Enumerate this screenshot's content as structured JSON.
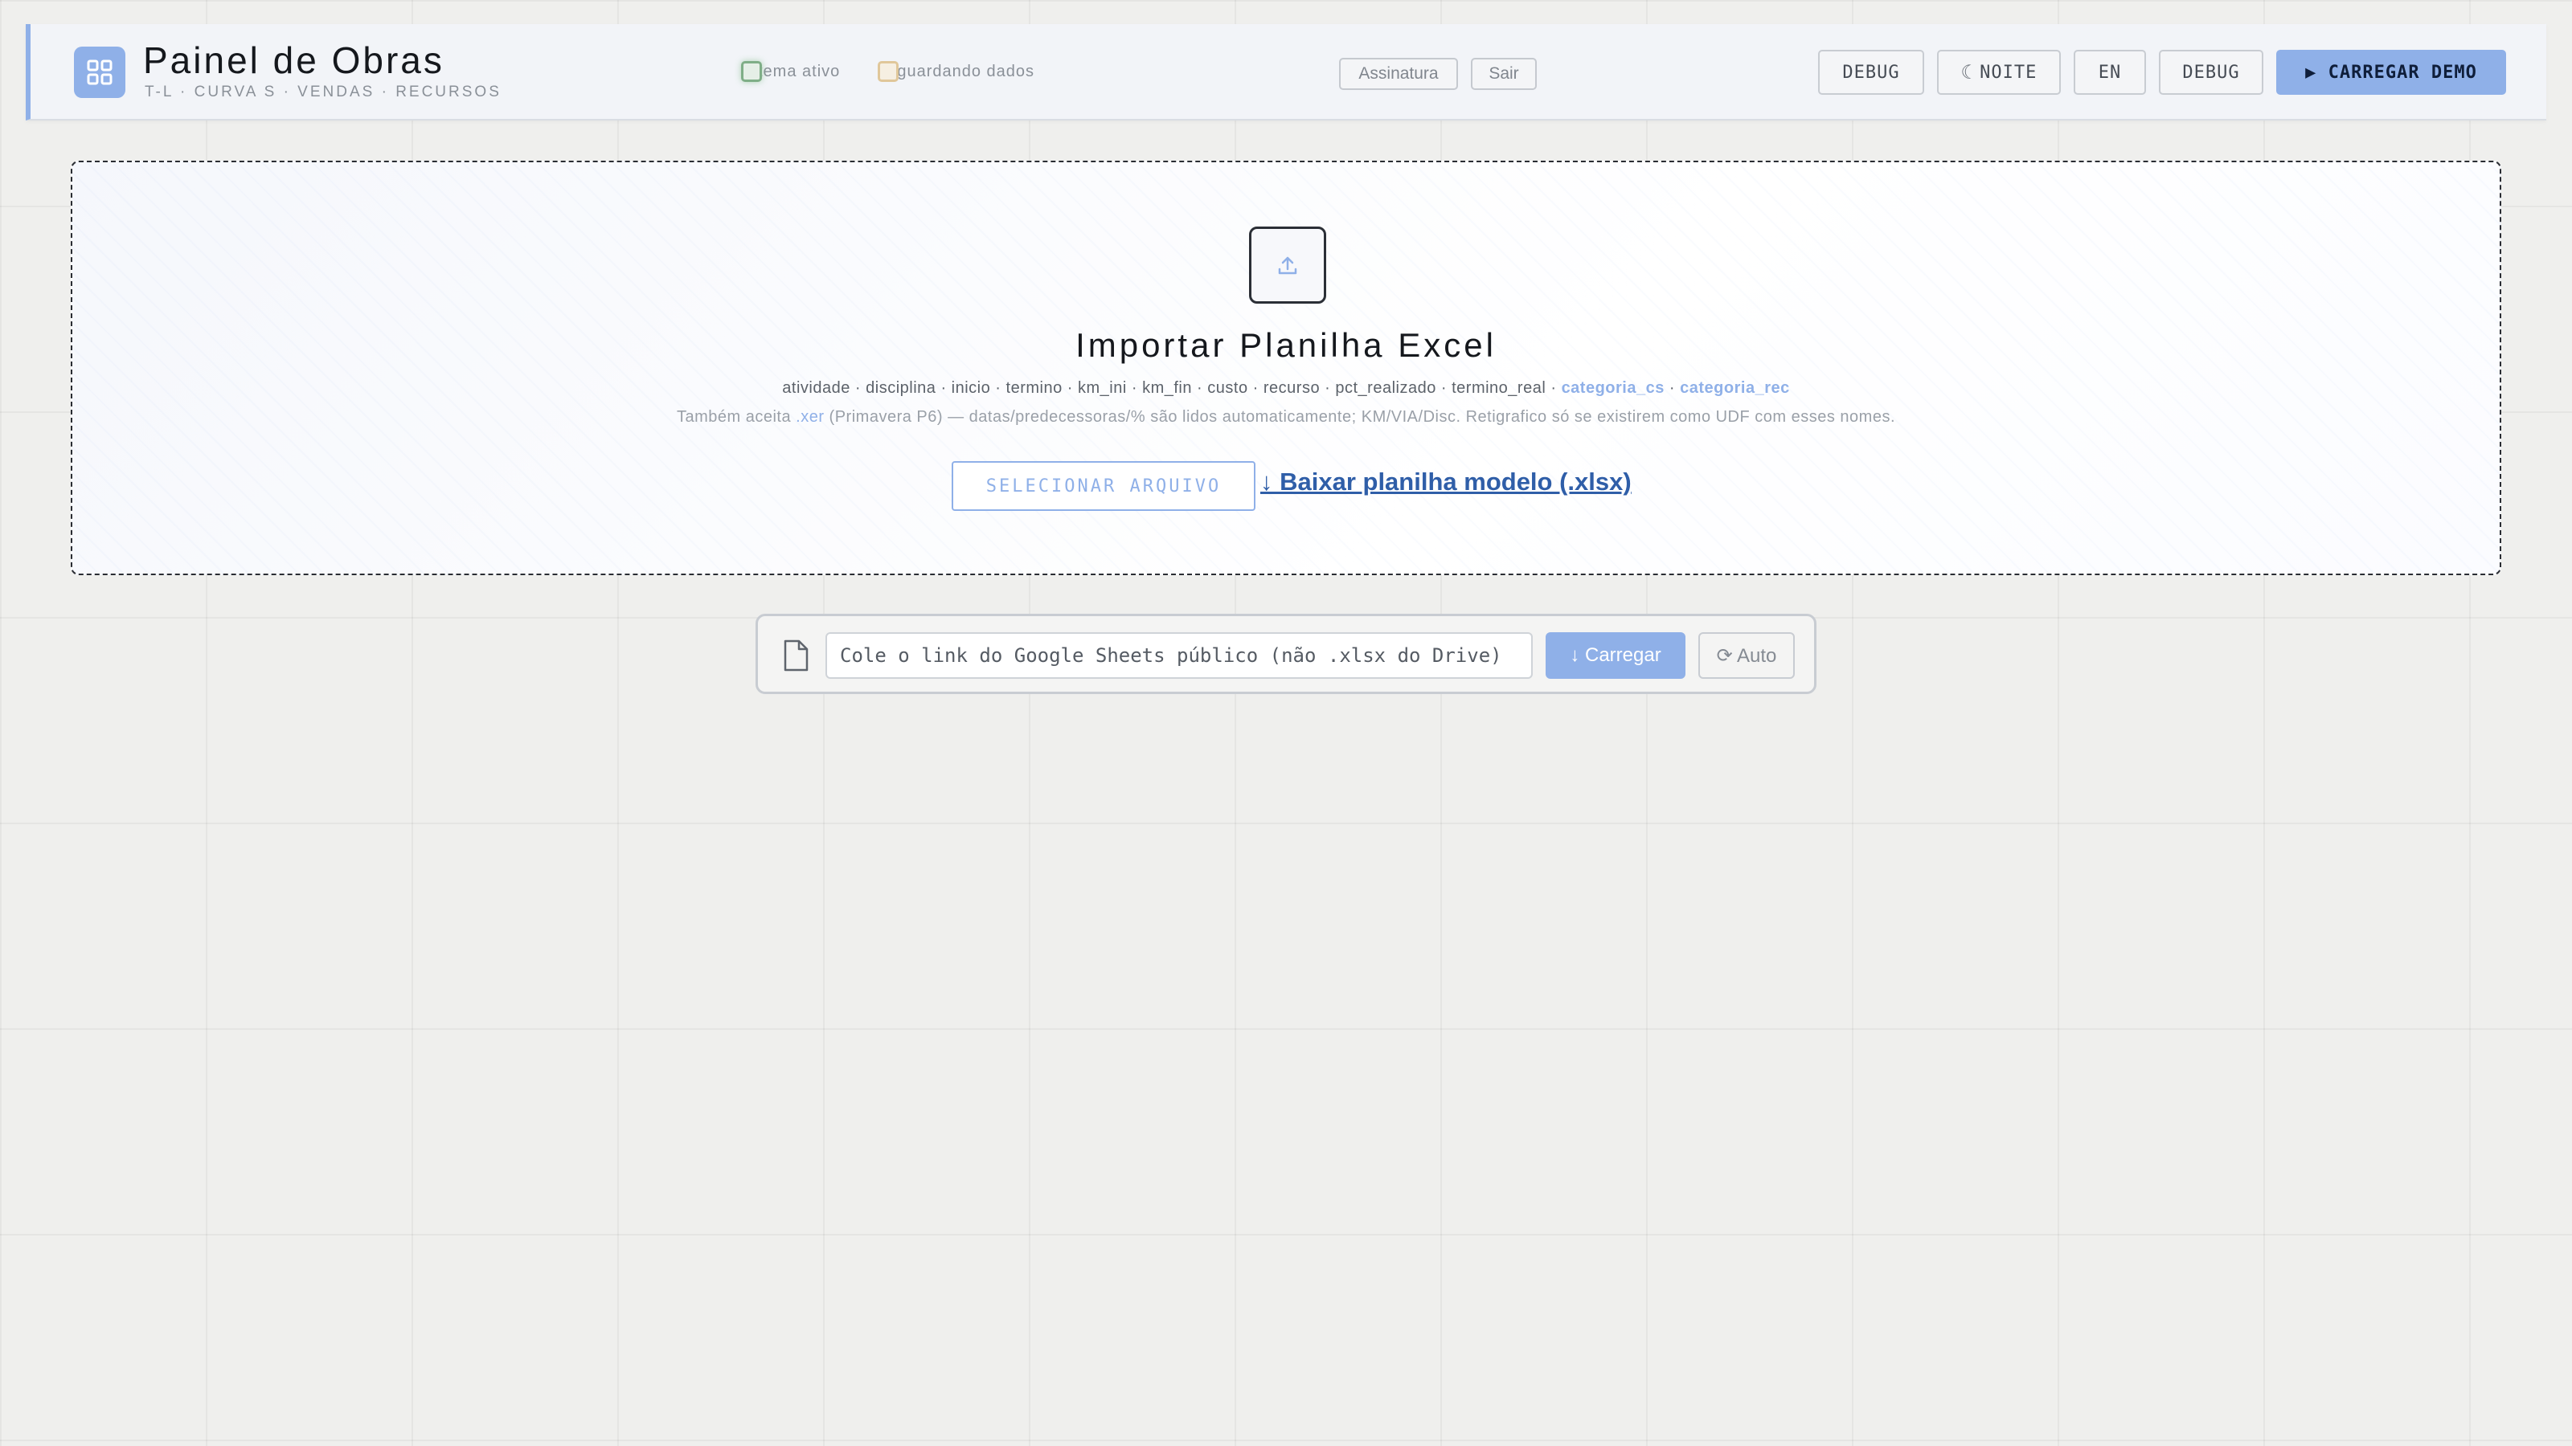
{
  "header": {
    "title": "Painel de Obras",
    "subtitle": "T-L · CURVA S · VENDAS · RECURSOS",
    "logo_icon": "grid-icon",
    "status": [
      {
        "label": "Sistema ativo",
        "color": "#7fae87"
      },
      {
        "label": "Aguardando dados",
        "color": "#e0c79a"
      }
    ],
    "visible_status_labels": [
      "stema ativo",
      "Aguardando dados"
    ],
    "signature_label": "Assinatura",
    "logout_label": "Sair",
    "debug_label": "DEBUG",
    "night_label": "NOITE",
    "night_icon": "moon-icon",
    "lang_label": "EN",
    "debug2_label": "DEBUG",
    "demo_label": "▶ CARREGAR DEMO"
  },
  "import": {
    "upload_icon": "upload-icon",
    "title": "Importar Planilha Excel",
    "fields": [
      "atividade",
      "disciplina",
      "inicio",
      "termino",
      "km_ini",
      "km_fin",
      "custo",
      "recurso",
      "pct_realizado",
      "termino_real"
    ],
    "highlight_fields": [
      "categoria_cs",
      "categoria_rec"
    ],
    "separator": " · ",
    "also_prefix": "Também aceita ",
    "also_ext": ".xer",
    "also_suffix": " (Primavera P6) — datas/predecessoras/% são lidos automaticamente; KM/VIA/Disc. Retigrafico só se existirem como UDF com esses nomes.",
    "select_label": "SELECIONAR ARQUIVO",
    "template_link": "↓ Baixar planilha modelo (.xlsx)"
  },
  "sheets": {
    "doc_icon": "document-icon",
    "placeholder": "Cole o link do Google Sheets público (não .xlsx do Drive)",
    "load_label": "↓ Carregar",
    "auto_label": "⟳ Auto"
  },
  "colors": {
    "accent": "#8fb0e8",
    "link": "#2f5ea8",
    "status_active": "#7fae87",
    "status_waiting": "#e0c79a"
  }
}
